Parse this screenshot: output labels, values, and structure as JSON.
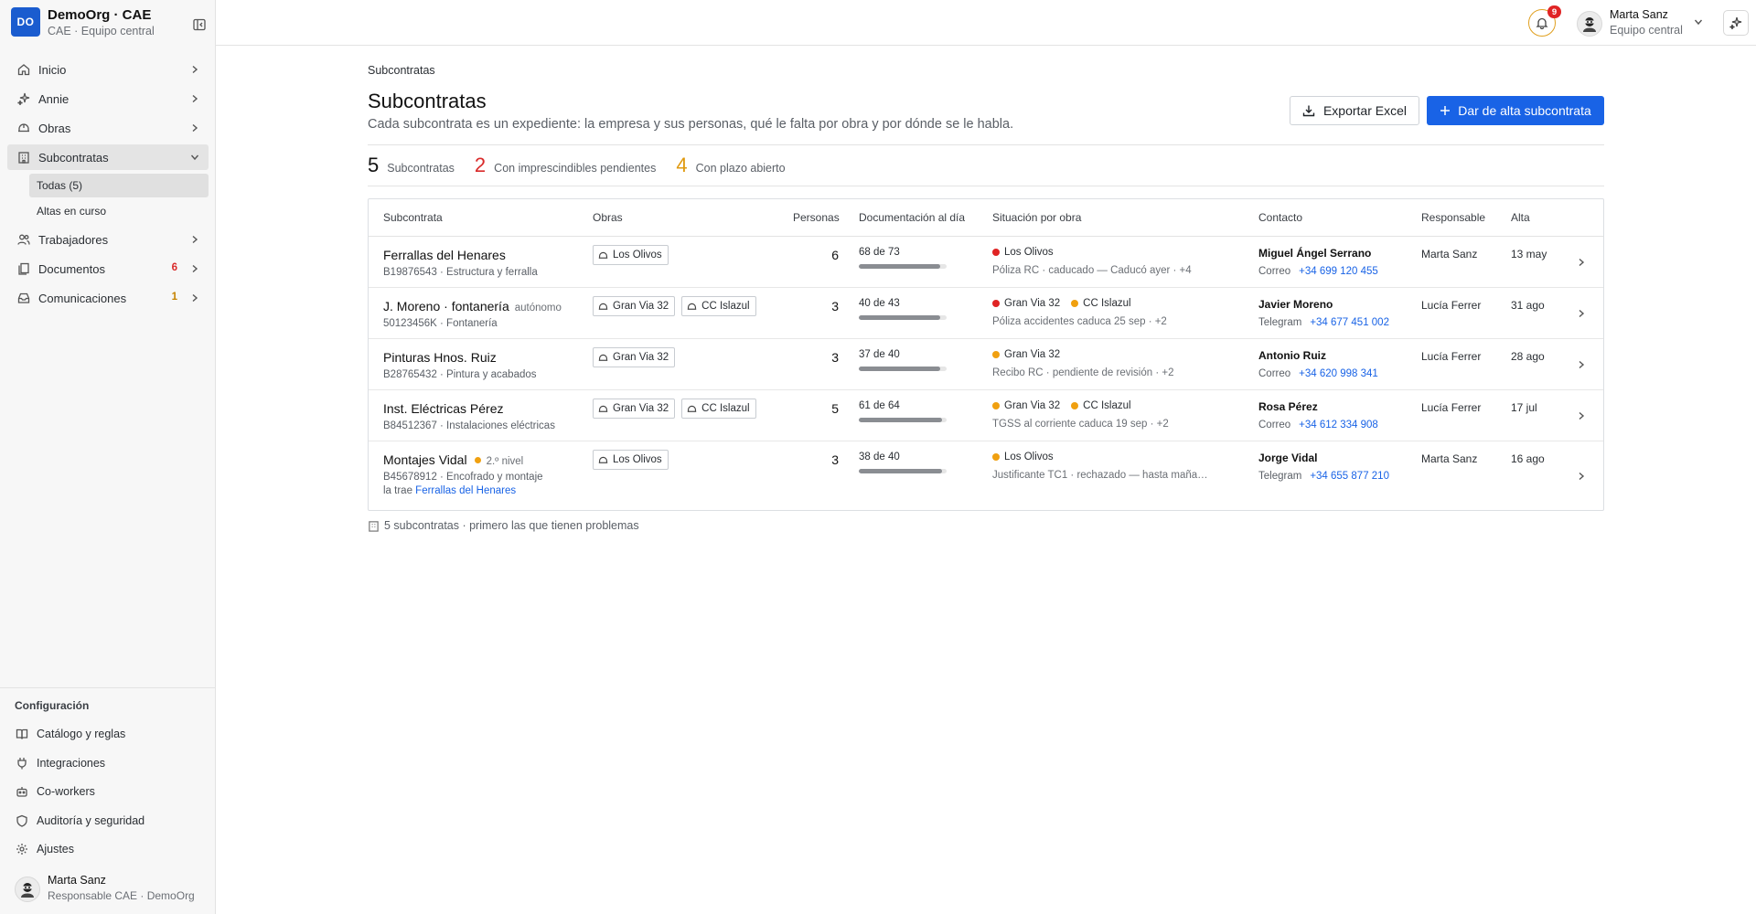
{
  "org": {
    "logo": "DO",
    "name": "DemoOrg · CAE",
    "subtitle": "CAE · Equipo central"
  },
  "nav": {
    "items": [
      {
        "label": "Inicio",
        "icon": "home-icon"
      },
      {
        "label": "Annie",
        "icon": "sparkle-icon"
      },
      {
        "label": "Obras",
        "icon": "hard-hat-icon"
      },
      {
        "label": "Subcontratas",
        "icon": "building-icon"
      },
      {
        "label": "Trabajadores",
        "icon": "users-icon"
      },
      {
        "label": "Documentos",
        "icon": "document-icon",
        "count": "6"
      },
      {
        "label": "Comunicaciones",
        "icon": "inbox-icon",
        "count": "1"
      }
    ],
    "sub_items": [
      {
        "label": "Todas (5)"
      },
      {
        "label": "Altas en curso"
      }
    ]
  },
  "config": {
    "title": "Configuración",
    "items": [
      {
        "label": "Catálogo y reglas",
        "icon": "book-icon"
      },
      {
        "label": "Integraciones",
        "icon": "plug-icon"
      },
      {
        "label": "Co-workers",
        "icon": "bot-icon"
      },
      {
        "label": "Auditoría y seguridad",
        "icon": "shield-icon"
      },
      {
        "label": "Ajustes",
        "icon": "gear-icon"
      }
    ]
  },
  "sidebar_user": {
    "name": "Marta Sanz",
    "role": "Responsable CAE · DemoOrg"
  },
  "topbar": {
    "notifications_count": "9",
    "user_name": "Marta Sanz",
    "user_role": "Equipo central"
  },
  "page": {
    "breadcrumb": "Subcontratas",
    "title": "Subcontratas",
    "description": "Cada subcontrata es un expediente: la empresa y sus personas, qué le falta por obra y por dónde se le habla.",
    "export_label": "Exportar Excel",
    "new_label": "Dar de alta subcontrata"
  },
  "stats": [
    {
      "value": "5",
      "label": "Subcontratas",
      "color": "#111111"
    },
    {
      "value": "2",
      "label": "Con imprescindibles pendientes",
      "color": "#d92a2a"
    },
    {
      "value": "4",
      "label": "Con plazo abierto",
      "color": "#e09a10"
    }
  ],
  "table": {
    "headers": {
      "subcontrata": "Subcontrata",
      "obras": "Obras",
      "personas": "Personas",
      "documentacion": "Documentación al día",
      "situacion": "Situación por obra",
      "contacto": "Contacto",
      "responsable": "Responsable",
      "alta": "Alta"
    },
    "rows": [
      {
        "name": "Ferrallas del Henares",
        "tag": "",
        "meta": "B19876543 · Estructura y ferralla",
        "obras": [
          "Los Olivos"
        ],
        "personas": "6",
        "doc_text": "68 de 73",
        "doc_fraction": 0.93,
        "situacion_obras": [
          {
            "name": "Los Olivos",
            "status": "#e02424"
          }
        ],
        "situacion_note": "Póliza RC · caducado — Caducó ayer · +4",
        "contact_name": "Miguel Ángel Serrano",
        "contact_channel": "Correo",
        "contact_phone": "+34 699 120 455",
        "responsable": "Marta Sanz",
        "alta": "13 may"
      },
      {
        "name": "J. Moreno · fontanería",
        "tag": "autónomo",
        "meta": "50123456K · Fontanería",
        "obras": [
          "Gran Via 32",
          "CC Islazul"
        ],
        "personas": "3",
        "doc_text": "40 de 43",
        "doc_fraction": 0.93,
        "situacion_obras": [
          {
            "name": "Gran Via 32",
            "status": "#e02424"
          },
          {
            "name": "CC Islazul",
            "status": "#f0a010"
          }
        ],
        "situacion_note": "Póliza accidentes caduca 25 sep · +2",
        "contact_name": "Javier Moreno",
        "contact_channel": "Telegram",
        "contact_phone": "+34 677 451 002",
        "responsable": "Lucía Ferrer",
        "alta": "31 ago"
      },
      {
        "name": "Pinturas Hnos. Ruiz",
        "tag": "",
        "meta": "B28765432 · Pintura y acabados",
        "obras": [
          "Gran Via 32"
        ],
        "personas": "3",
        "doc_text": "37 de 40",
        "doc_fraction": 0.925,
        "situacion_obras": [
          {
            "name": "Gran Via 32",
            "status": "#f0a010"
          }
        ],
        "situacion_note": "Recibo RC · pendiente de revisión · +2",
        "contact_name": "Antonio Ruiz",
        "contact_channel": "Correo",
        "contact_phone": "+34 620 998 341",
        "responsable": "Lucía Ferrer",
        "alta": "28 ago"
      },
      {
        "name": "Inst. Eléctricas Pérez",
        "tag": "",
        "meta": "B84512367 · Instalaciones eléctricas",
        "obras": [
          "Gran Via 32",
          "CC Islazul"
        ],
        "personas": "5",
        "doc_text": "61 de 64",
        "doc_fraction": 0.95,
        "situacion_obras": [
          {
            "name": "Gran Via 32",
            "status": "#f0a010"
          },
          {
            "name": "CC Islazul",
            "status": "#f0a010"
          }
        ],
        "situacion_note": "TGSS al corriente caduca 19 sep · +2",
        "contact_name": "Rosa Pérez",
        "contact_channel": "Correo",
        "contact_phone": "+34 612 334 908",
        "responsable": "Lucía Ferrer",
        "alta": "17 jul"
      },
      {
        "name": "Montajes Vidal",
        "tag": "2.º nivel",
        "meta": "B45678912 · Encofrado y montaje",
        "brought_prefix": "la trae",
        "brought_by": "Ferrallas del Henares",
        "obras": [
          "Los Olivos"
        ],
        "personas": "3",
        "doc_text": "38 de 40",
        "doc_fraction": 0.95,
        "situacion_obras": [
          {
            "name": "Los Olivos",
            "status": "#f0a010"
          }
        ],
        "situacion_note": "Justificante TC1 · rechazado — hasta mañana …",
        "contact_name": "Jorge Vidal",
        "contact_channel": "Telegram",
        "contact_phone": "+34 655 877 210",
        "responsable": "Marta Sanz",
        "alta": "16 ago"
      }
    ]
  },
  "footnote": "5 subcontratas · primero las que tienen problemas"
}
